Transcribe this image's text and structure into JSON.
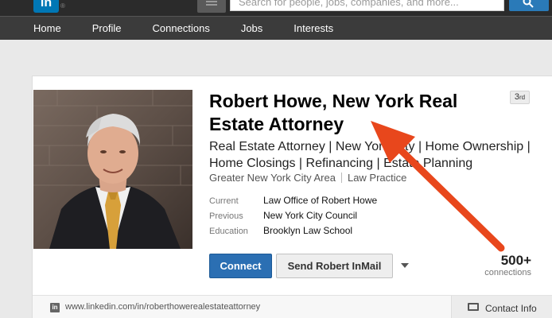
{
  "topbar": {
    "logo_text": "in",
    "logo_mark": "®",
    "search_placeholder": "Search for people, jobs, companies, and more..."
  },
  "nav": {
    "items": [
      "Home",
      "Profile",
      "Connections",
      "Jobs",
      "Interests"
    ]
  },
  "profile": {
    "degree_num": "3",
    "degree_suffix": "rd",
    "name": "Robert Howe, New York Real Estate Attorney",
    "headline": "Real Estate Attorney | New York City | Home Ownership | Home Closings | Refinancing | Estate Planning",
    "location": "Greater New York City Area",
    "industry": "Law Practice",
    "current_label": "Current",
    "current_value": "Law Office of Robert Howe",
    "previous_label": "Previous",
    "previous_value": "New York City Council",
    "education_label": "Education",
    "education_value": "Brooklyn Law School",
    "connect_label": "Connect",
    "inmail_label": "Send Robert InMail",
    "connections_count": "500+",
    "connections_label": "connections"
  },
  "footer": {
    "url": "www.linkedin.com/in/roberthowerealestateattorney",
    "contact_label": "Contact Info"
  },
  "colors": {
    "brand": "#0077b5",
    "connect_button": "#2b6fb3",
    "annotation_arrow": "#e8471c"
  }
}
